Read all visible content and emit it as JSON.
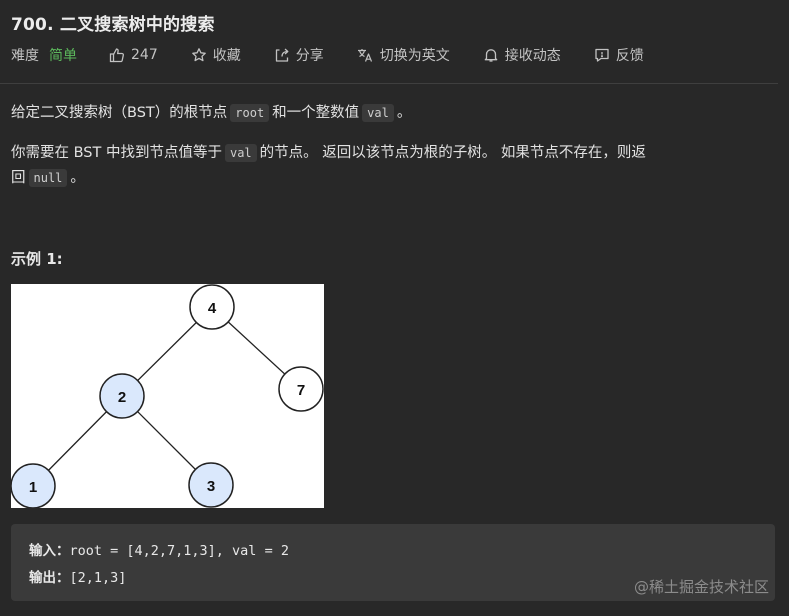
{
  "problem": {
    "title": "700. 二叉搜索树中的搜索"
  },
  "meta": {
    "difficulty_label": "难度",
    "difficulty_value": "简单",
    "difficulty_color": "#5cb85c",
    "likes": "247",
    "favorite_label": "收藏",
    "share_label": "分享",
    "translate_label": "切换为英文",
    "notify_label": "接收动态",
    "feedback_label": "反馈"
  },
  "description": {
    "p1_before": "给定二叉搜索树（BST）的根节点",
    "p1_code1": "root",
    "p1_middle": "和一个整数值",
    "p1_code2": "val",
    "p1_after": "。",
    "p2_line1_before": "你需要在 BST 中找到节点值等于",
    "p2_code1": "val",
    "p2_line1_after": "的节点。 返回以该节点为根的子树。 如果节点不存在，则返",
    "p2_line2_before": "回",
    "p2_code2": "null",
    "p2_line2_after": "。"
  },
  "example": {
    "title": "示例 1:",
    "input_label": "输入：",
    "input_value": "root = [4,2,7,1,3], val = 2",
    "output_label": "输出：",
    "output_value": "[2,1,3]"
  },
  "tree": {
    "nodes": [
      {
        "label": "4",
        "highlighted": false
      },
      {
        "label": "2",
        "highlighted": true
      },
      {
        "label": "7",
        "highlighted": false
      },
      {
        "label": "1",
        "highlighted": true
      },
      {
        "label": "3",
        "highlighted": true
      }
    ],
    "highlight_color": "#dae8fc"
  },
  "watermark": "@稀土掘金技术社区"
}
